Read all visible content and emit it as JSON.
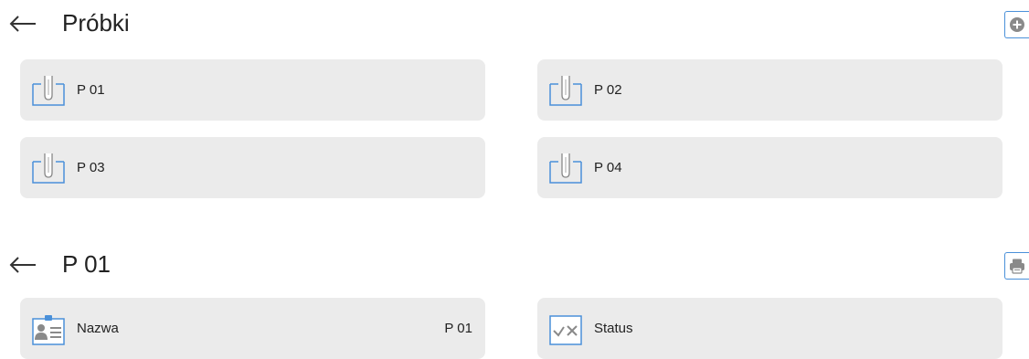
{
  "samples_screen": {
    "title": "Próbki",
    "back_icon": "arrow-left-icon",
    "add_icon": "plus-circle-icon",
    "items": [
      {
        "label": "P 01",
        "icon": "test-tube-icon"
      },
      {
        "label": "P 02",
        "icon": "test-tube-icon"
      },
      {
        "label": "P 03",
        "icon": "test-tube-icon"
      },
      {
        "label": "P 04",
        "icon": "test-tube-icon"
      }
    ]
  },
  "sample_detail": {
    "title": "P 01",
    "back_icon": "arrow-left-icon",
    "print_icon": "printer-icon",
    "fields": [
      {
        "label": "Nazwa",
        "value": "P 01",
        "icon": "id-card-icon"
      },
      {
        "label": "Status",
        "value": "",
        "icon": "check-cross-icon"
      }
    ]
  },
  "colors": {
    "accent": "#4a90d9",
    "tile_bg": "#ebebeb",
    "icon_gray": "#8a8a8a"
  }
}
